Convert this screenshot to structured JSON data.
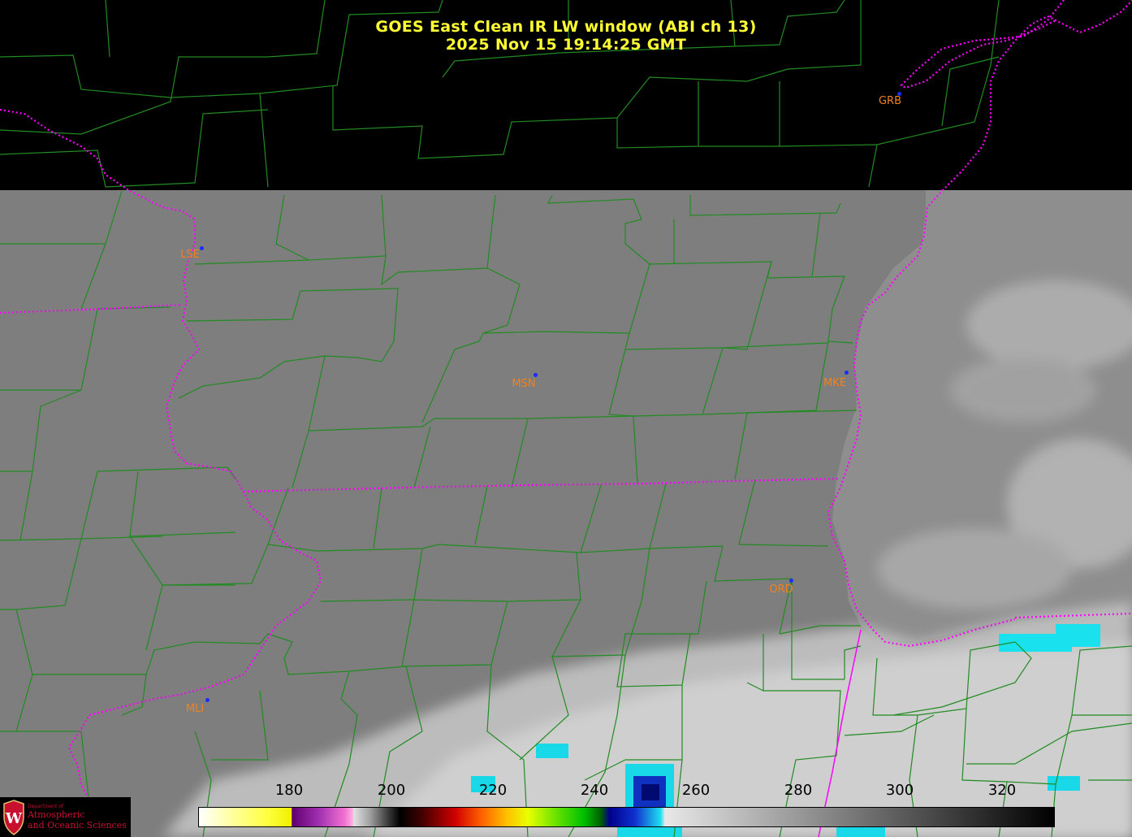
{
  "title": {
    "line1": "GOES East Clean IR LW window (ABI ch 13)",
    "line2": "2025 Nov 15  19:14:25 GMT"
  },
  "cities": [
    {
      "label": "GRB"
    },
    {
      "label": "LSE"
    },
    {
      "label": "MSN"
    },
    {
      "label": "MKE"
    },
    {
      "label": "ORD"
    },
    {
      "label": "MLI"
    }
  ],
  "colorbar": {
    "ticks": [
      "180",
      "200",
      "220",
      "240",
      "260",
      "280",
      "300",
      "320"
    ]
  },
  "logo": {
    "line1": "Department of",
    "line2": "Atmospheric",
    "line3": "and Oceanic Sciences",
    "emblem_letter": "W"
  },
  "colors": {
    "title": "#ffff33",
    "county_lines": "#228b22",
    "state_lines": "#ff00ff",
    "city_label": "#f0821e",
    "city_dot": "#1a2cff",
    "logo_red": "#c8102e"
  }
}
